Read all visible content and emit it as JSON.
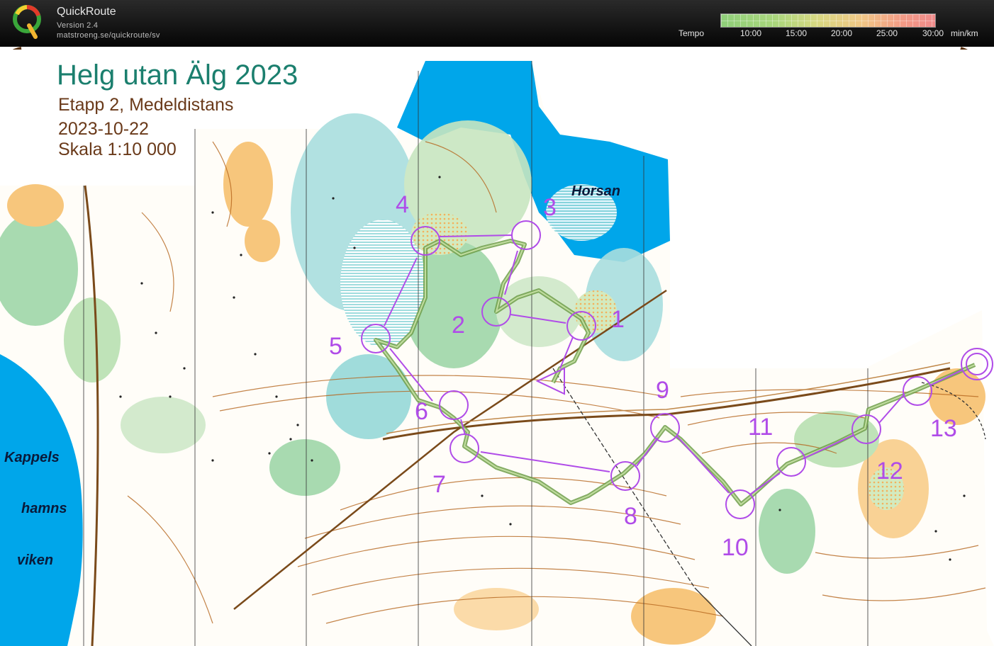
{
  "app": {
    "name": "QuickRoute",
    "version": "Version 2.4",
    "url": "matstroeng.se/quickroute/sv",
    "logo_letter": "Q"
  },
  "tempo": {
    "label": "Tempo",
    "ticks": [
      "10:00",
      "15:00",
      "20:00",
      "25:00",
      "30:00"
    ],
    "unit": "min/km",
    "colors": [
      "#8fcf7a",
      "#d8d882",
      "#f0c886",
      "#ef8a8a"
    ]
  },
  "map": {
    "title": "Helg utan Älg 2023",
    "stage": "Etapp 2, Medeldistans",
    "date": "2023-10-22",
    "scale": "Skala 1:10 000",
    "places": {
      "horsan": "Horsan",
      "kappels": "Kappels",
      "hamns": "hamns",
      "viken": "viken"
    },
    "controls": [
      "1",
      "2",
      "3",
      "4",
      "5",
      "6",
      "7",
      "8",
      "9",
      "10",
      "11",
      "12",
      "13"
    ],
    "colors": {
      "water": "#00a6ea",
      "forest_green": "#9fd6a8",
      "marsh": "#4fbfc2",
      "open_land": "#f7c06e",
      "contour": "#b5651d",
      "course": "#b04ce8",
      "route": "#7fae5a"
    }
  }
}
